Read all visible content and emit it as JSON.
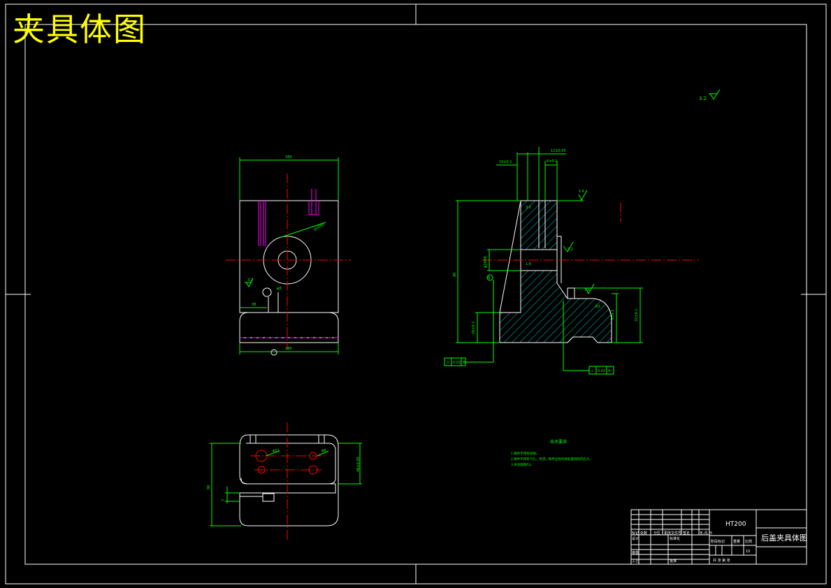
{
  "overlay_title": "夹具体图",
  "roughness_general": "3.2",
  "material": "HT200",
  "part_name": "后盖夹具体图",
  "tech_req_title": "技术要求",
  "tech_req_lines": [
    "1.铸件不得有砂眼。",
    "2.铸件不得有气孔、夹渣，铸件应经时效处理消除内应力。",
    "3.未注圆角R3。"
  ],
  "scale": "1:1",
  "sheet_count_value": "10",
  "title_block_labels": {
    "mark": "标记",
    "count": "处数",
    "zone": "分区",
    "doc_no": "更改文件号",
    "sign": "签名",
    "date": "年.月.日",
    "design": "设计",
    "standard": "标准化",
    "review": "审核",
    "process": "工艺",
    "approve": "批准",
    "stage_mark": "阶段标记",
    "weight": "重量",
    "ratio": "比例",
    "sheets": "共 张 第 张"
  },
  "colors": {
    "outline": "#ffffff",
    "dimension": "#00ff00",
    "centerline": "#ff0000",
    "hidden": "#ff00ff",
    "hatch": "#00ffff",
    "title": "#ffff00"
  }
}
